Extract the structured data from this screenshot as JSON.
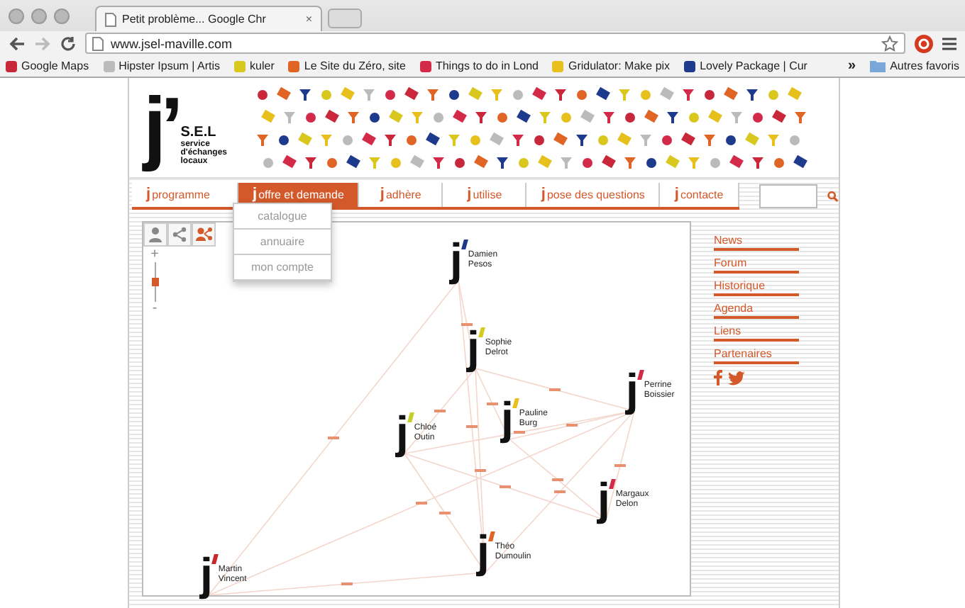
{
  "browser": {
    "tabs": [
      {
        "title": "Petit problème... Google Chr",
        "close": "×",
        "selected": true
      }
    ],
    "url": "www.jsel-maville.com",
    "bookmarks": [
      {
        "label": "Google Maps"
      },
      {
        "label": "Hipster Ipsum | Artis"
      },
      {
        "label": "kuler"
      },
      {
        "label": "Le Site du Zéro, site"
      },
      {
        "label": "Things to do in Lond"
      },
      {
        "label": "Gridulator: Make pix"
      },
      {
        "label": "Lovely Package | Cur"
      }
    ],
    "overflow": "»",
    "other_bookmarks": "Autres favoris"
  },
  "logo": {
    "mark": "j’",
    "name": "S.E.L",
    "tagline": "service d'échanges locaux"
  },
  "nav": [
    {
      "mark": "j",
      "label": "programme",
      "selected": false
    },
    {
      "mark": "j",
      "label": "offre et demande",
      "selected": true
    },
    {
      "mark": "j",
      "label": "adhère",
      "selected": false
    },
    {
      "mark": "j",
      "label": "utilise",
      "selected": false
    },
    {
      "mark": "j",
      "label": "pose des questions",
      "selected": false
    },
    {
      "mark": "j",
      "label": "contacte",
      "selected": false
    }
  ],
  "dropdown": [
    "catalogue",
    "annuaire",
    "mon compte"
  ],
  "tools": [
    {
      "kind": "person",
      "selected": false
    },
    {
      "kind": "share",
      "selected": false
    },
    {
      "kind": "network",
      "selected": true
    }
  ],
  "zoom": {
    "plus": "+",
    "minus": "-",
    "level": 0.5
  },
  "nodes": [
    {
      "mark": "j",
      "first": "Damien",
      "last": "Pesos",
      "color": "#1e3a8c"
    },
    {
      "mark": "j",
      "first": "Sophie",
      "last": "Delrot",
      "color": "#d4cc1e"
    },
    {
      "mark": "j",
      "first": "Perrine",
      "last": "Boissier",
      "color": "#d42a4a"
    },
    {
      "mark": "j",
      "first": "Pauline",
      "last": "Burg",
      "color": "#e8c01c"
    },
    {
      "mark": "j",
      "first": "Chloé",
      "last": "Outin",
      "color": "#c8cc2a"
    },
    {
      "mark": "j",
      "first": "Margaux",
      "last": "Delon",
      "color": "#d42a4a"
    },
    {
      "mark": "j",
      "first": "Théo",
      "last": "Dumoulin",
      "color": "#e06424"
    },
    {
      "mark": "j",
      "first": "Martin",
      "last": "Vincent",
      "color": "#c8282a"
    }
  ],
  "side_links": [
    "News",
    "Forum",
    "Historique",
    "Agenda",
    "Liens",
    "Partenaires"
  ]
}
